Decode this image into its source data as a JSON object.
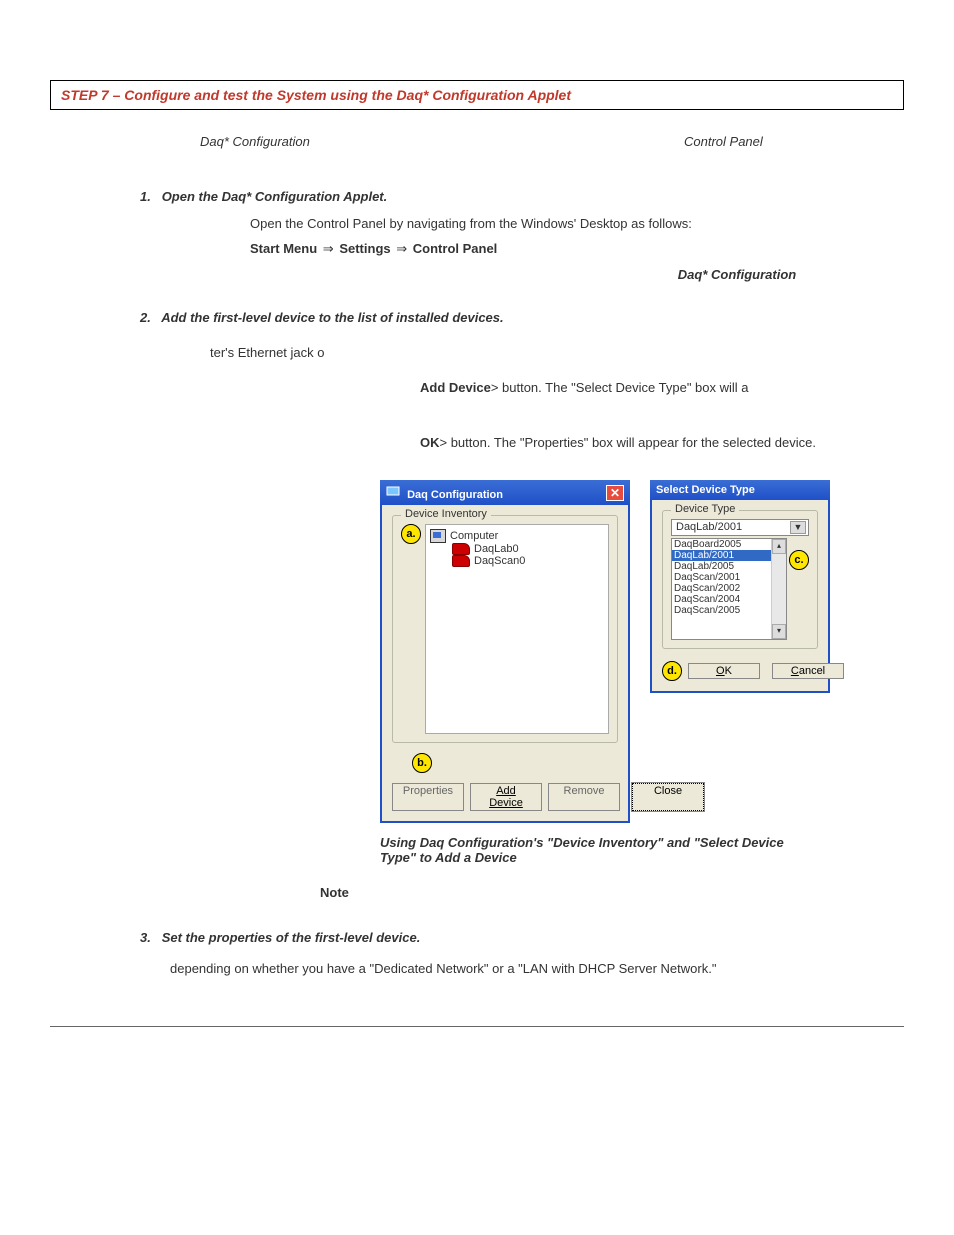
{
  "header": {
    "title": "STEP 7  –  Configure and test the System using the Daq* Configuration Applet"
  },
  "labels": {
    "left": "Daq* Configuration",
    "right": "Control Panel"
  },
  "steps": {
    "s1": {
      "num": "1.",
      "title": "Open the Daq* Configuration Applet.",
      "body1": "Open the Control Panel by navigating from the Windows' Desktop as follows:",
      "nav1": "Start Menu",
      "nav2": "Settings",
      "nav3": "Control Panel",
      "daq_label": "Daq* Configuration"
    },
    "s2": {
      "num": "2.",
      "title": "Add the first-level device to the list of installed devices.",
      "frag1": "ter's Ethernet jack o",
      "frag2a": "Add Device",
      "frag2b": "> button.  The \"Select Device Type\" box will a",
      "frag3a": "OK",
      "frag3b": "> button.  The \"Properties\" box will appear for the selected device."
    },
    "caption": "Using Daq Configuration's \"Device Inventory\" and \"Select Device Type\" to Add a Device",
    "note": "Note",
    "s3": {
      "num": "3.",
      "title": "Set the properties of the first-level device.",
      "body": "depending on whether you have a \"Dedicated Network\" or a \"LAN with DHCP Server Network.\""
    }
  },
  "dialog1": {
    "title": "Daq Configuration",
    "group": "Device Inventory",
    "tree_root": "Computer",
    "tree_items": [
      "DaqLab0",
      "DaqScan0"
    ],
    "callout_a": "a.",
    "callout_b": "b.",
    "btn_props": "Properties",
    "btn_add": "Add Device",
    "btn_remove": "Remove",
    "btn_close": "Close"
  },
  "dialog2": {
    "title": "Select Device Type",
    "group": "Device Type",
    "combo_value": "DaqLab/2001",
    "callout_c": "c.",
    "callout_d": "d.",
    "list": [
      {
        "label": "DaqBoard2005",
        "sel": false
      },
      {
        "label": "DaqLab/2001",
        "sel": true
      },
      {
        "label": "DaqLab/2005",
        "sel": false
      },
      {
        "label": "DaqScan/2001",
        "sel": false
      },
      {
        "label": "DaqScan/2002",
        "sel": false
      },
      {
        "label": "DaqScan/2004",
        "sel": false
      },
      {
        "label": "DaqScan/2005",
        "sel": false
      }
    ],
    "btn_ok": "OK",
    "btn_cancel": "Cancel",
    "scroll_up": "▴",
    "scroll_down": "▾"
  }
}
